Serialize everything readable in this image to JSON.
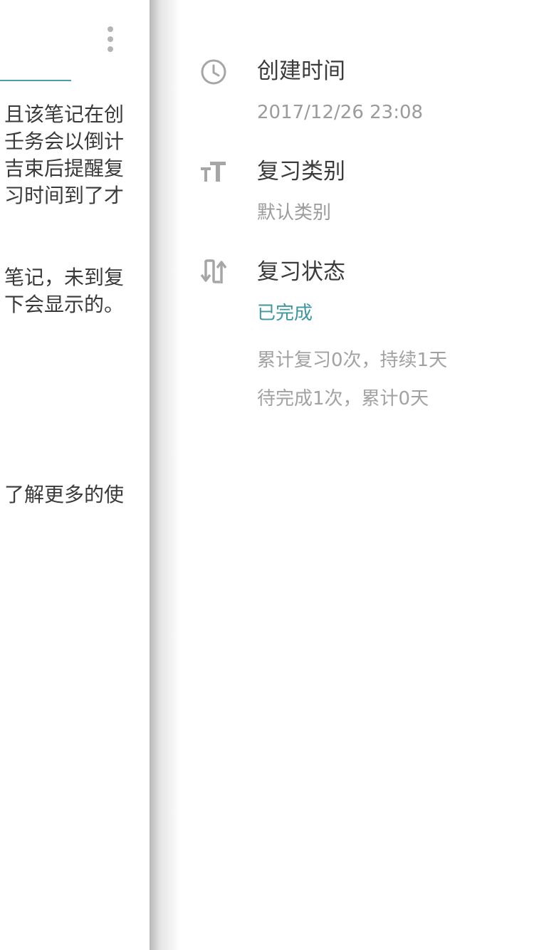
{
  "note_page": {
    "menu_icon": "more-vertical-icon",
    "paragraphs": [
      {
        "lines": [
          "且该笔记在创",
          "壬务会以倒计",
          "吉束后提醒复",
          "习时间到了才"
        ]
      },
      {
        "lines": [
          "笔记，未到复",
          "下会显示的。"
        ]
      },
      {
        "lines": [
          "了解更多的使"
        ]
      }
    ]
  },
  "drawer": {
    "created": {
      "icon": "clock-icon",
      "title": "创建时间",
      "value": "2017/12/26 23:08"
    },
    "category": {
      "icon": "text-size-icon",
      "title": "复习类别",
      "value": "默认类别"
    },
    "status": {
      "icon": "swap-arrows-icon",
      "title": "复习状态",
      "value": "已完成",
      "stats": [
        "累计复习0次，持续1天",
        "待完成1次，累计0天"
      ]
    }
  },
  "colors": {
    "accent": "#3c97a0",
    "title_text": "#3b3b3b",
    "secondary_text": "#9b9b9b",
    "icon": "#a6a6a6"
  }
}
